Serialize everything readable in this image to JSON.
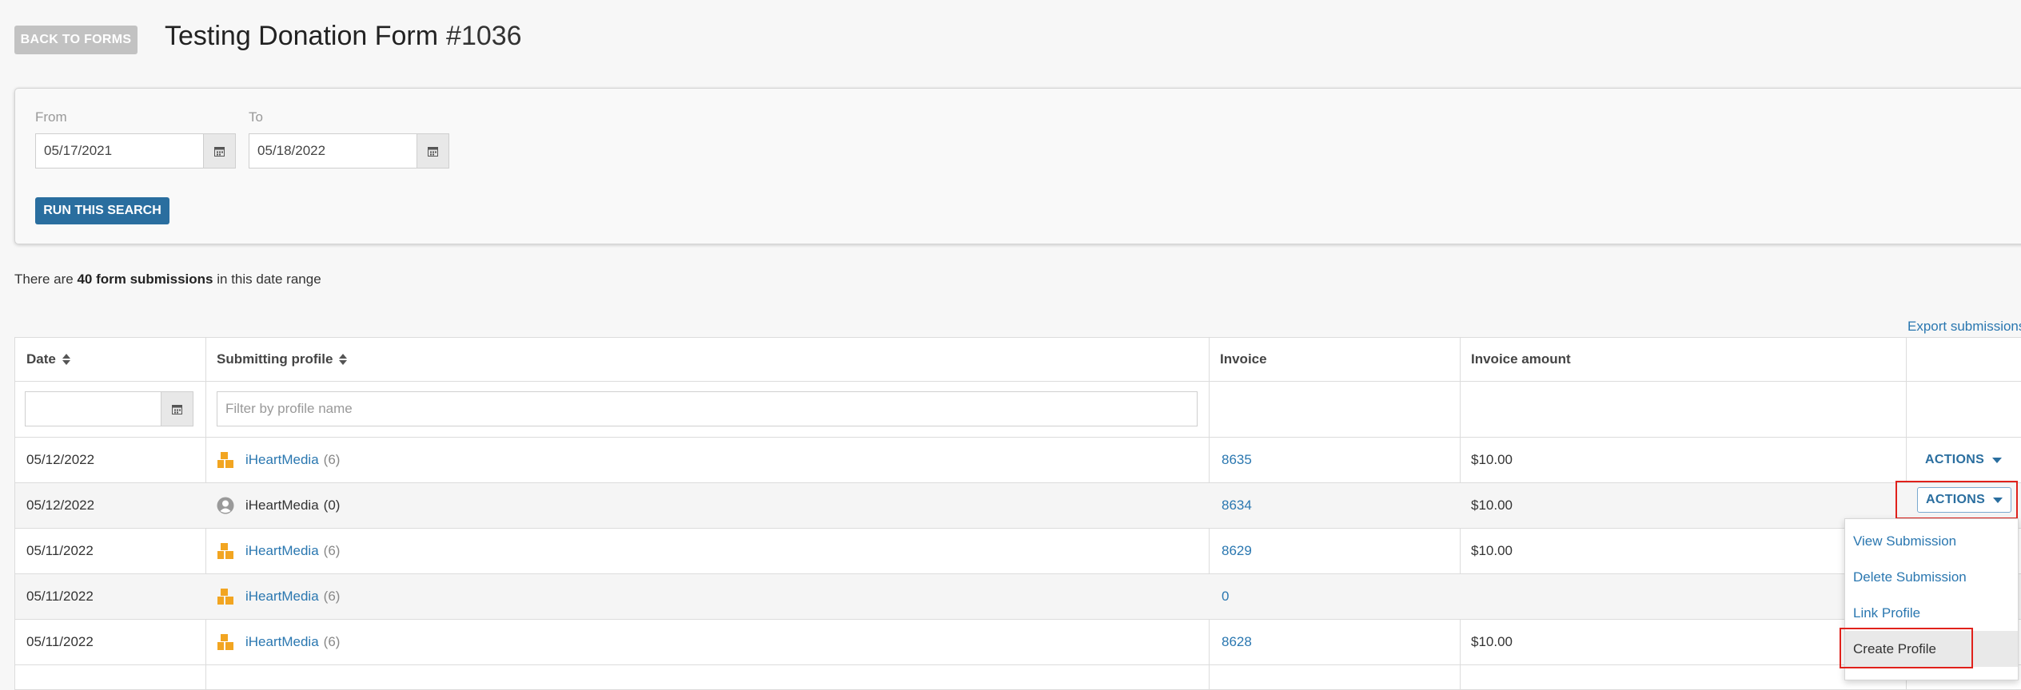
{
  "header": {
    "back_label": "BACK TO FORMS",
    "title": "Testing Donation Form",
    "form_number": "#1036"
  },
  "search": {
    "from_label": "From",
    "from_value": "05/17/2021",
    "to_label": "To",
    "to_value": "05/18/2022",
    "run_label": "RUN THIS SEARCH"
  },
  "summary": {
    "prefix": "There are",
    "count_text": "40 form submissions",
    "suffix": "in this date range"
  },
  "export_label": "Export submissions",
  "table": {
    "columns": [
      "Date",
      "Submitting profile",
      "Invoice",
      "Invoice amount"
    ],
    "profile_filter_placeholder": "Filter by profile name",
    "rows": [
      {
        "date": "05/12/2022",
        "profile": "iHeartMedia",
        "count": "(6)",
        "icon": "organization-icon",
        "linked": true,
        "invoice": "8635",
        "amount": "$10.00",
        "actions": "ACTIONS"
      },
      {
        "date": "05/12/2022",
        "profile": "iHeartMedia",
        "count": "(0)",
        "icon": "person-icon",
        "linked": false,
        "invoice": "8634",
        "amount": "$10.00",
        "actions": "ACTIONS"
      },
      {
        "date": "05/11/2022",
        "profile": "iHeartMedia",
        "count": "(6)",
        "icon": "organization-icon",
        "linked": true,
        "invoice": "8629",
        "amount": "$10.00",
        "actions": ""
      },
      {
        "date": "05/11/2022",
        "profile": "iHeartMedia",
        "count": "(6)",
        "icon": "organization-icon",
        "linked": true,
        "invoice": "0",
        "amount": "",
        "actions": ""
      },
      {
        "date": "05/11/2022",
        "profile": "iHeartMedia",
        "count": "(6)",
        "icon": "organization-icon",
        "linked": true,
        "invoice": "8628",
        "amount": "$10.00",
        "actions": ""
      }
    ]
  },
  "actions_menu": {
    "items": [
      "View Submission",
      "Delete Submission",
      "Link Profile",
      "Create Profile"
    ],
    "highlighted": "Create Profile"
  },
  "colors": {
    "accent": "#2a6e9f",
    "link": "#2a77b0",
    "org_icon": "#f2a521",
    "highlight_border": "#e0211b"
  }
}
